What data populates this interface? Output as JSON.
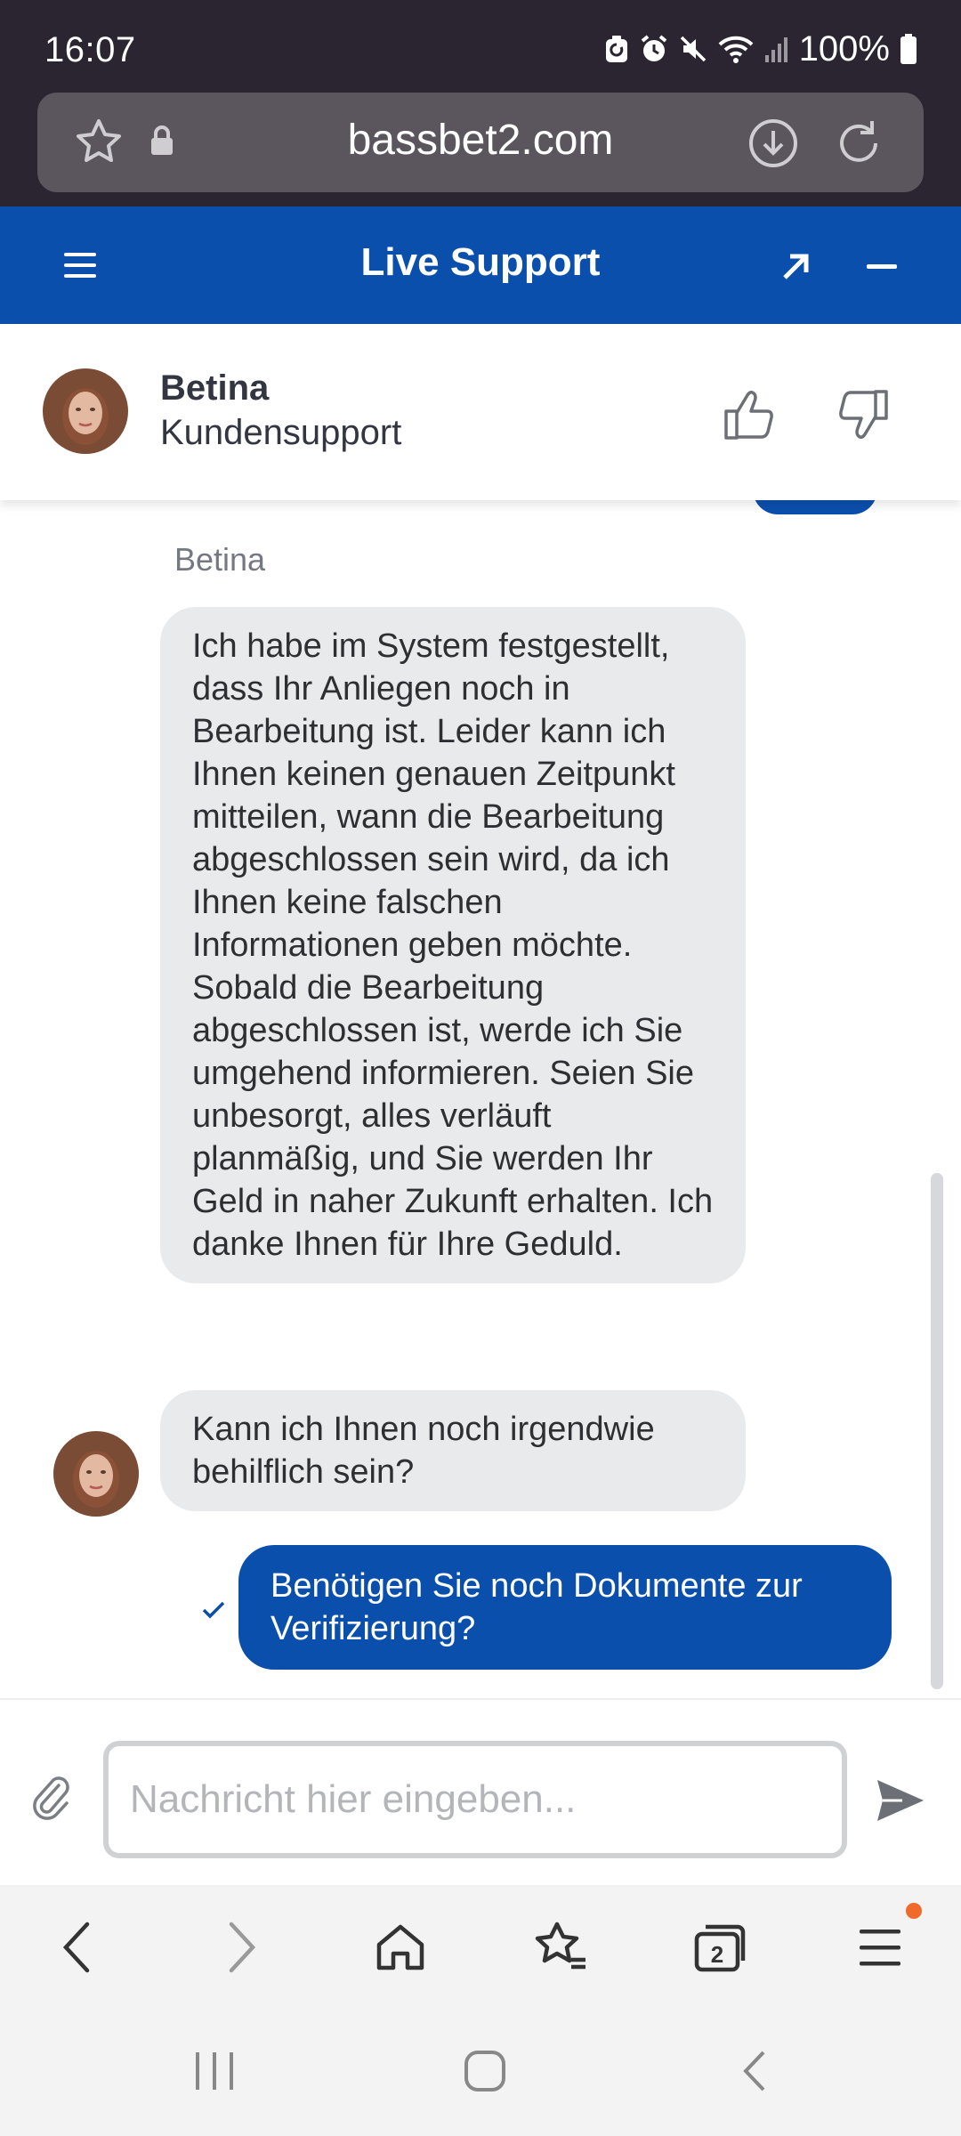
{
  "status_bar": {
    "time": "16:07",
    "battery": "100%"
  },
  "browser": {
    "url": "bassbet2.com",
    "tab_count": "2"
  },
  "header": {
    "title": "Live Support"
  },
  "agent": {
    "name": "Betina",
    "role": "Kundensupport"
  },
  "chat": {
    "sender_label": "Betina",
    "messages": [
      {
        "direction": "incoming",
        "text": "Ich habe im System festgestellt, dass Ihr Anliegen noch in Bearbeitung ist. Leider kann ich Ihnen keinen genauen Zeitpunkt mitteilen, wann die Bearbeitung abgeschlossen sein wird, da ich Ihnen keine falschen Informationen geben möchte. Sobald die Bearbeitung abgeschlossen ist, werde ich Sie umgehend informieren. Seien Sie unbesorgt, alles verläuft planmäßig, und Sie werden Ihr Geld in naher Zukunft erhalten. Ich danke Ihnen für Ihre Geduld."
      },
      {
        "direction": "incoming",
        "text": "Kann ich Ihnen noch irgendwie behilflich sein?"
      },
      {
        "direction": "outgoing",
        "text": "Benötigen Sie noch Dokumente zur Verifizierung?"
      }
    ]
  },
  "composer": {
    "placeholder": "Nachricht hier eingeben..."
  },
  "colors": {
    "brand_blue": "#0b4fad",
    "incoming_bubble": "#e9eaec",
    "notification_dot": "#f06a2a"
  },
  "icons": {
    "status": [
      "battery-saver-icon",
      "alarm-icon",
      "mute-icon",
      "wifi-icon",
      "signal-icon",
      "battery-icon"
    ],
    "browser_bar": [
      "bookmark-star-icon",
      "lock-icon",
      "download-icon",
      "reload-icon"
    ],
    "header": [
      "menu-icon",
      "popout-icon",
      "minimize-icon"
    ],
    "agent": [
      "thumbs-up-icon",
      "thumbs-down-icon"
    ],
    "composer": [
      "attach-icon",
      "send-icon"
    ],
    "browser_nav": [
      "back-icon",
      "forward-icon",
      "home-icon",
      "bookmarks-icon",
      "tabs-icon",
      "browser-menu-icon"
    ],
    "system_nav": [
      "recents-icon",
      "home-circle-icon",
      "system-back-icon"
    ]
  }
}
